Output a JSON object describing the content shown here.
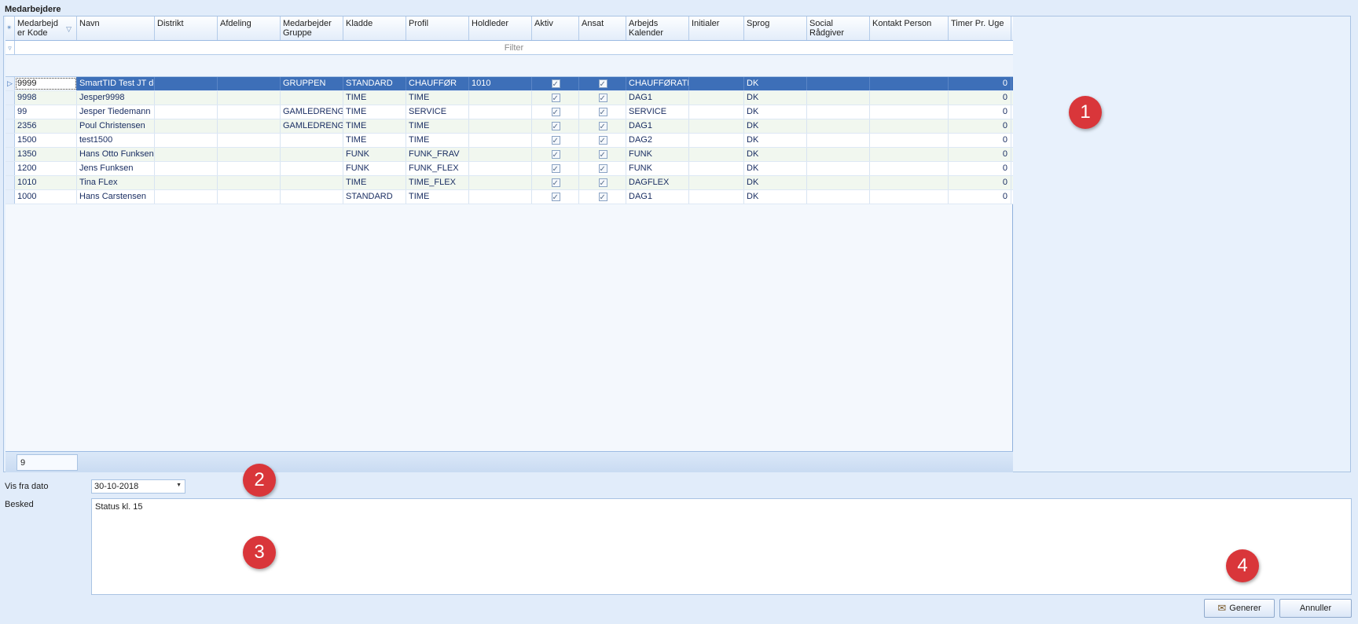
{
  "group_title": "Medarbejdere",
  "grid": {
    "columns": [
      {
        "key": "kode",
        "label": "Medarbejd\ner Kode",
        "width": 79
      },
      {
        "key": "navn",
        "label": "Navn",
        "width": 99
      },
      {
        "key": "distrikt",
        "label": "Distrikt",
        "width": 80
      },
      {
        "key": "afdeling",
        "label": "Afdeling",
        "width": 80
      },
      {
        "key": "gruppe",
        "label": "Medarbejder\nGruppe",
        "width": 80
      },
      {
        "key": "kladde",
        "label": "Kladde",
        "width": 80
      },
      {
        "key": "profil",
        "label": "Profil",
        "width": 80
      },
      {
        "key": "holdleder",
        "label": "Holdleder",
        "width": 80
      },
      {
        "key": "aktiv",
        "label": "Aktiv",
        "width": 60
      },
      {
        "key": "ansat",
        "label": "Ansat",
        "width": 60
      },
      {
        "key": "kalender",
        "label": "Arbejds\nKalender",
        "width": 80
      },
      {
        "key": "initialer",
        "label": "Initialer",
        "width": 70
      },
      {
        "key": "sprog",
        "label": "Sprog",
        "width": 80
      },
      {
        "key": "social",
        "label": "Social Rådgiver",
        "width": 80
      },
      {
        "key": "kontakt",
        "label": "Kontakt Person",
        "width": 100
      },
      {
        "key": "timer",
        "label": "Timer Pr. Uge",
        "width": 80
      }
    ],
    "filter_label": "Filter",
    "rows": [
      {
        "kode": "9999",
        "navn": "SmartTID Test JT de",
        "distrikt": "",
        "afdeling": "",
        "gruppe": "GRUPPEN",
        "kladde": "STANDARD",
        "profil": "CHAUFFØR",
        "holdleder": "1010",
        "aktiv": true,
        "ansat": true,
        "kalender": "CHAUFFØRATL",
        "initialer": "",
        "sprog": "DK",
        "social": "",
        "kontakt": "",
        "timer": "0"
      },
      {
        "kode": "9998",
        "navn": "Jesper9998",
        "distrikt": "",
        "afdeling": "",
        "gruppe": "",
        "kladde": "TIME",
        "profil": "TIME",
        "holdleder": "",
        "aktiv": true,
        "ansat": true,
        "kalender": "DAG1",
        "initialer": "",
        "sprog": "DK",
        "social": "",
        "kontakt": "",
        "timer": "0"
      },
      {
        "kode": "99",
        "navn": "Jesper Tiedemann",
        "distrikt": "",
        "afdeling": "",
        "gruppe": "GAMLEDRENGE",
        "kladde": "TIME",
        "profil": "SERVICE",
        "holdleder": "",
        "aktiv": true,
        "ansat": true,
        "kalender": "SERVICE",
        "initialer": "",
        "sprog": "DK",
        "social": "",
        "kontakt": "",
        "timer": "0"
      },
      {
        "kode": "2356",
        "navn": "Poul Christensen",
        "distrikt": "",
        "afdeling": "",
        "gruppe": "GAMLEDRENGE",
        "kladde": "TIME",
        "profil": "TIME",
        "holdleder": "",
        "aktiv": true,
        "ansat": true,
        "kalender": "DAG1",
        "initialer": "",
        "sprog": "DK",
        "social": "",
        "kontakt": "",
        "timer": "0"
      },
      {
        "kode": "1500",
        "navn": "test1500",
        "distrikt": "",
        "afdeling": "",
        "gruppe": "",
        "kladde": "TIME",
        "profil": "TIME",
        "holdleder": "",
        "aktiv": true,
        "ansat": true,
        "kalender": "DAG2",
        "initialer": "",
        "sprog": "DK",
        "social": "",
        "kontakt": "",
        "timer": "0"
      },
      {
        "kode": "1350",
        "navn": "Hans Otto Funksen",
        "distrikt": "",
        "afdeling": "",
        "gruppe": "",
        "kladde": "FUNK",
        "profil": "FUNK_FRAV",
        "holdleder": "",
        "aktiv": true,
        "ansat": true,
        "kalender": "FUNK",
        "initialer": "",
        "sprog": "DK",
        "social": "",
        "kontakt": "",
        "timer": "0"
      },
      {
        "kode": "1200",
        "navn": "Jens Funksen",
        "distrikt": "",
        "afdeling": "",
        "gruppe": "",
        "kladde": "FUNK",
        "profil": "FUNK_FLEX",
        "holdleder": "",
        "aktiv": true,
        "ansat": true,
        "kalender": "FUNK",
        "initialer": "",
        "sprog": "DK",
        "social": "",
        "kontakt": "",
        "timer": "0"
      },
      {
        "kode": "1010",
        "navn": "Tina FLex",
        "distrikt": "",
        "afdeling": "",
        "gruppe": "",
        "kladde": "TIME",
        "profil": "TIME_FLEX",
        "holdleder": "",
        "aktiv": true,
        "ansat": true,
        "kalender": "DAGFLEX",
        "initialer": "",
        "sprog": "DK",
        "social": "",
        "kontakt": "",
        "timer": "0"
      },
      {
        "kode": "1000",
        "navn": "Hans Carstensen",
        "distrikt": "",
        "afdeling": "",
        "gruppe": "",
        "kladde": "STANDARD",
        "profil": "TIME",
        "holdleder": "",
        "aktiv": true,
        "ansat": true,
        "kalender": "DAG1",
        "initialer": "",
        "sprog": "DK",
        "social": "",
        "kontakt": "",
        "timer": "0"
      }
    ],
    "footer_count": "9"
  },
  "form": {
    "date_label": "Vis fra dato",
    "date_value": "30-10-2018",
    "message_label": "Besked",
    "message_value": "Status kl.  15"
  },
  "buttons": {
    "generate": "Generer",
    "cancel": "Annuller"
  },
  "badges": [
    "1",
    "2",
    "3",
    "4"
  ],
  "colors": {
    "selected_row": "#3d6fb8",
    "badge": "#d9363a",
    "background": "#e1ecfa"
  }
}
